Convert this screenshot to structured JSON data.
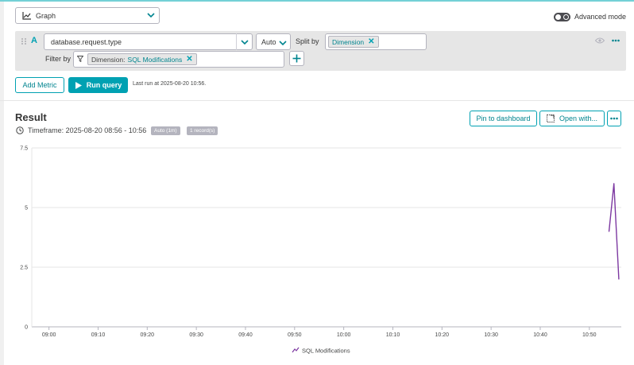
{
  "header": {
    "visualization": "Graph",
    "advanced_mode_label": "Advanced mode",
    "advanced_mode_on": true
  },
  "query": {
    "letter": "A",
    "metric": "database.request.type",
    "aggregation": "Auto",
    "split_by_label": "Split by",
    "split_by_chip": "Dimension",
    "filter_by_label": "Filter by",
    "filter_chip_key": "Dimension:",
    "filter_chip_value": "SQL Modifications"
  },
  "actions": {
    "add_metric": "Add Metric",
    "run_query": "Run query",
    "last_run": "Last run at 2025-08-20 10:56."
  },
  "result": {
    "title": "Result",
    "timeframe": "Timeframe: 2025-08-20 08:56 - 10:56",
    "badge_resolution": "Auto (1m)",
    "badge_records": "1 record(s)",
    "pin_button": "Pin to dashboard",
    "open_button": "Open with..."
  },
  "colors": {
    "accent": "#00a1b2",
    "series": "#7c38a1"
  },
  "chart_data": {
    "type": "line",
    "title": "",
    "xlabel": "",
    "ylabel": "",
    "ylim": [
      0,
      7.5
    ],
    "y_ticks": [
      "7.5",
      "5",
      "2.5",
      "0"
    ],
    "y_tick_values": [
      7.5,
      5,
      2.5,
      0
    ],
    "x_ticks": [
      "09:00",
      "09:10",
      "09:20",
      "09:30",
      "09:40",
      "09:50",
      "10:00",
      "10:10",
      "10:20",
      "10:30",
      "10:40",
      "10:50"
    ],
    "x_tick_minutes": [
      0,
      10,
      20,
      30,
      40,
      50,
      60,
      70,
      80,
      90,
      100,
      110
    ],
    "x_range_minutes": [
      -3.5,
      116.5
    ],
    "grid": true,
    "legend": "bottom",
    "series": [
      {
        "name": "SQL Modifications",
        "x": [
          "10:54",
          "10:55",
          "10:56"
        ],
        "x_minutes": [
          114,
          115,
          116
        ],
        "values": [
          4,
          6,
          2
        ]
      }
    ]
  }
}
